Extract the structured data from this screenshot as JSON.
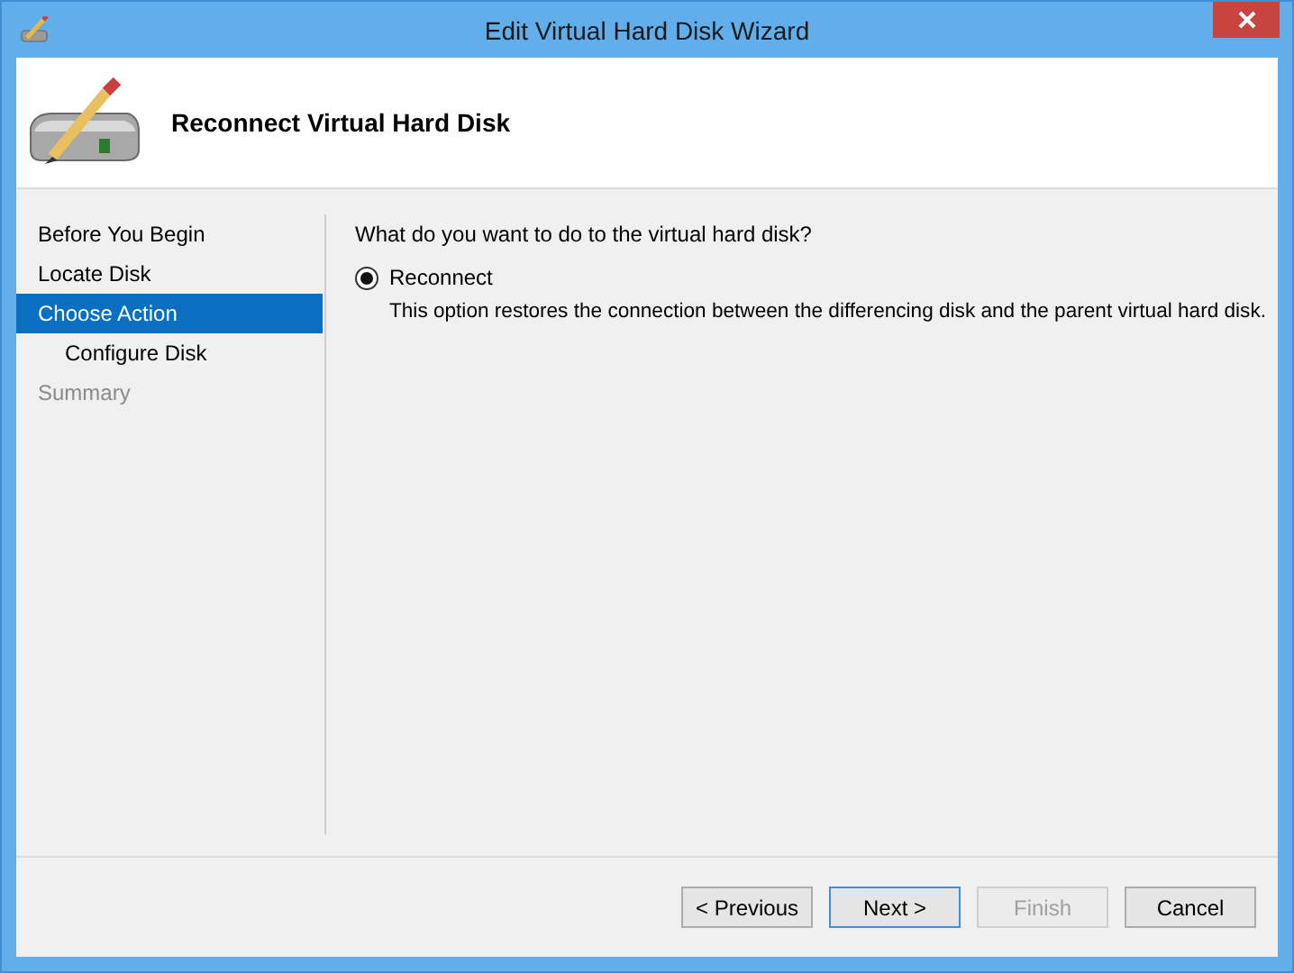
{
  "window": {
    "title": "Edit Virtual Hard Disk Wizard"
  },
  "header": {
    "title": "Reconnect Virtual Hard Disk"
  },
  "steps": [
    {
      "label": "Before You Begin",
      "selected": false,
      "disabled": false
    },
    {
      "label": "Locate Disk",
      "selected": false,
      "disabled": false
    },
    {
      "label": "Choose Action",
      "selected": true,
      "disabled": false,
      "children": [
        {
          "label": "Configure Disk",
          "selected": false,
          "disabled": false
        }
      ]
    },
    {
      "label": "Summary",
      "selected": false,
      "disabled": true
    }
  ],
  "question": "What do you want to do to the virtual hard disk?",
  "options": [
    {
      "label": "Reconnect",
      "description": "This option restores the connection between the differencing disk and the parent virtual hard disk.",
      "selected": true
    }
  ],
  "buttons": [
    {
      "label": "< Previous",
      "disabled": false,
      "default": false
    },
    {
      "label": "Next >",
      "disabled": false,
      "default": true
    },
    {
      "label": "Finish",
      "disabled": true,
      "default": false
    },
    {
      "label": "Cancel",
      "disabled": false,
      "default": false
    }
  ]
}
